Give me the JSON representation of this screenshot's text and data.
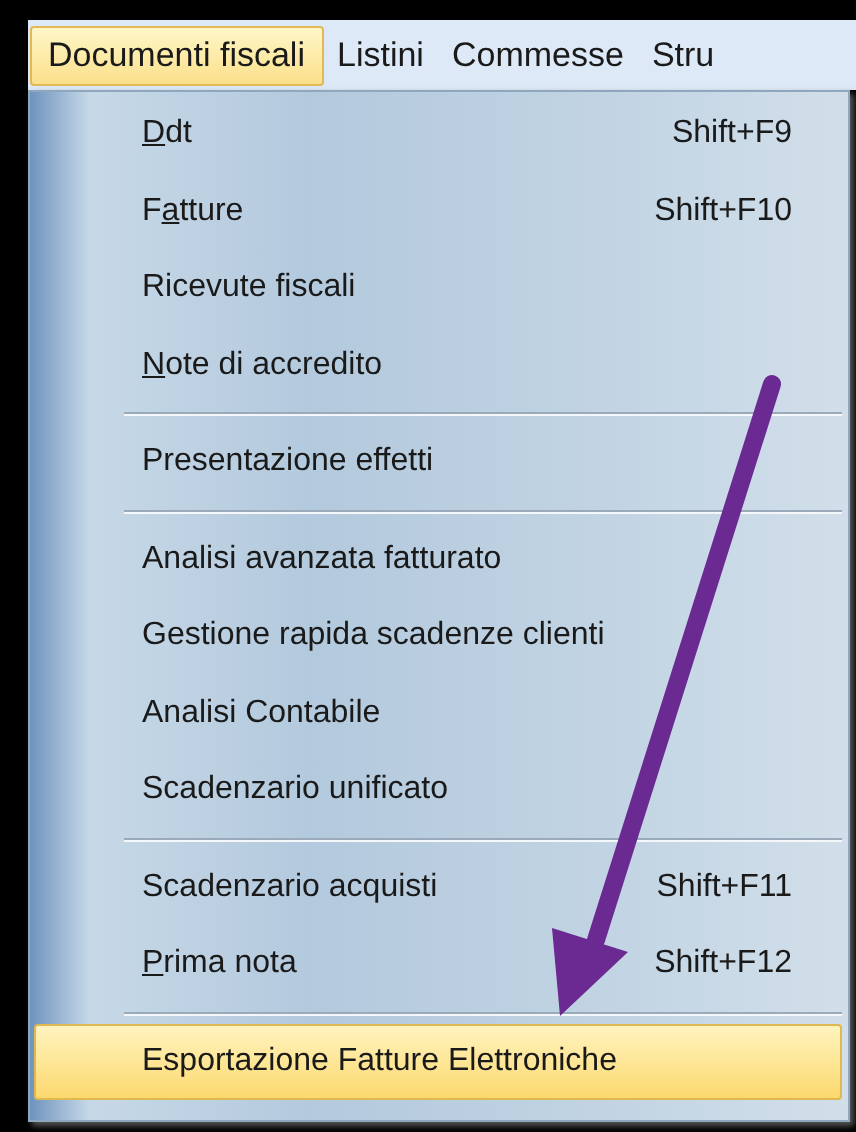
{
  "menubar": {
    "items": [
      {
        "label": "Documenti fiscali",
        "selected": true
      },
      {
        "label": "Listini",
        "selected": false
      },
      {
        "label": "Commesse",
        "selected": false
      },
      {
        "label": "Stru",
        "selected": false
      }
    ]
  },
  "menu": {
    "entries": [
      {
        "kind": "item",
        "label_parts": [
          {
            "text": "D",
            "underlined": true
          },
          {
            "text": "dt",
            "underlined": false
          }
        ],
        "shortcut": "Shift+F9",
        "selected": false
      },
      {
        "kind": "item",
        "label_parts": [
          {
            "text": "F",
            "underlined": false
          },
          {
            "text": "a",
            "underlined": true
          },
          {
            "text": "tture",
            "underlined": false
          }
        ],
        "shortcut": "Shift+F10",
        "selected": false
      },
      {
        "kind": "item",
        "label": "Ricevute fiscali",
        "selected": false
      },
      {
        "kind": "item",
        "label_parts": [
          {
            "text": "N",
            "underlined": true
          },
          {
            "text": "ote di accredito",
            "underlined": false
          }
        ],
        "selected": false
      },
      {
        "kind": "separator"
      },
      {
        "kind": "item",
        "label": "Presentazione effetti",
        "selected": false
      },
      {
        "kind": "separator"
      },
      {
        "kind": "item",
        "label": "Analisi avanzata fatturato",
        "selected": false
      },
      {
        "kind": "item",
        "label": "Gestione rapida scadenze clienti",
        "selected": false
      },
      {
        "kind": "item",
        "label": "Analisi Contabile",
        "selected": false
      },
      {
        "kind": "item",
        "label": "Scadenzario unificato",
        "selected": false
      },
      {
        "kind": "separator"
      },
      {
        "kind": "item",
        "label": "Scadenzario acquisti",
        "shortcut": "Shift+F11",
        "selected": false
      },
      {
        "kind": "item",
        "label_parts": [
          {
            "text": "P",
            "underlined": true
          },
          {
            "text": "rima nota",
            "underlined": false
          }
        ],
        "shortcut": "Shift+F12",
        "selected": false
      },
      {
        "kind": "separator"
      },
      {
        "kind": "item",
        "label": "Esportazione Fatture Elettroniche",
        "selected": true
      }
    ]
  }
}
